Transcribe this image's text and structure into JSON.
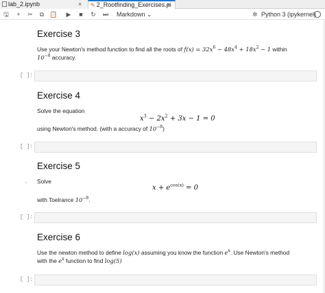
{
  "tabs": [
    {
      "label": "lab_2.ipynb",
      "close": "×"
    },
    {
      "label": "2_Rootfinding_Exercises.pi",
      "close": "×"
    }
  ],
  "toolbar": {
    "save": "🖫",
    "add": "+",
    "cut": "✂",
    "copy": "⧉",
    "paste": "📋",
    "run": "▶",
    "stop": "■",
    "restart": "↻",
    "fast_forward": "⏭",
    "cell_type": "Markdown",
    "cell_type_arrow": "⌄",
    "kernel_gear": "✲",
    "kernel_name": "Python 3 (ipykernel)"
  },
  "prompt_label": "[ ]:",
  "ex3": {
    "title": "Exercise 3",
    "text_a": "Use your Newton's method function to find all the roots of ",
    "fx": "f(x) = 32x",
    "e6": "6",
    "t2": " − 48x",
    "e4": "4",
    "t3": " + 18x",
    "e2": "2",
    "t4": " − 1",
    "text_b": " within",
    "tol": "10",
    "tol_exp": "−8",
    "text_c": " accuracy."
  },
  "ex4": {
    "title": "Exercise 4",
    "intro": "Solve the equation",
    "eq_a": "x",
    "eq_e3": "3",
    "eq_b": " − 2x",
    "eq_e2": "2",
    "eq_c": " + 3x − 1 = 0",
    "using_a": "using Newton's method. (with a accuracy of ",
    "tol": "10",
    "tol_exp": "−8",
    "using_b": ")"
  },
  "ex5": {
    "title": "Exercise 5",
    "intro": "Solve",
    "eq_a": "x + e",
    "eq_exp": "cos(x)",
    "eq_b": " = 0",
    "tol_a": "with Toelrance ",
    "tol": "10",
    "tol_exp": "−8",
    "tol_b": "."
  },
  "ex6": {
    "title": "Exercise 6",
    "line1_a": "Use the newton method to define ",
    "log": "log(x)",
    "line1_b": " assuming you know the function ",
    "ex": "e",
    "ex_exp": "x",
    "line1_c": ". Use Newton's method",
    "line2_a": "with the ",
    "line2_b": " function to find ",
    "log5": "log(5)"
  },
  "bullet": "-"
}
